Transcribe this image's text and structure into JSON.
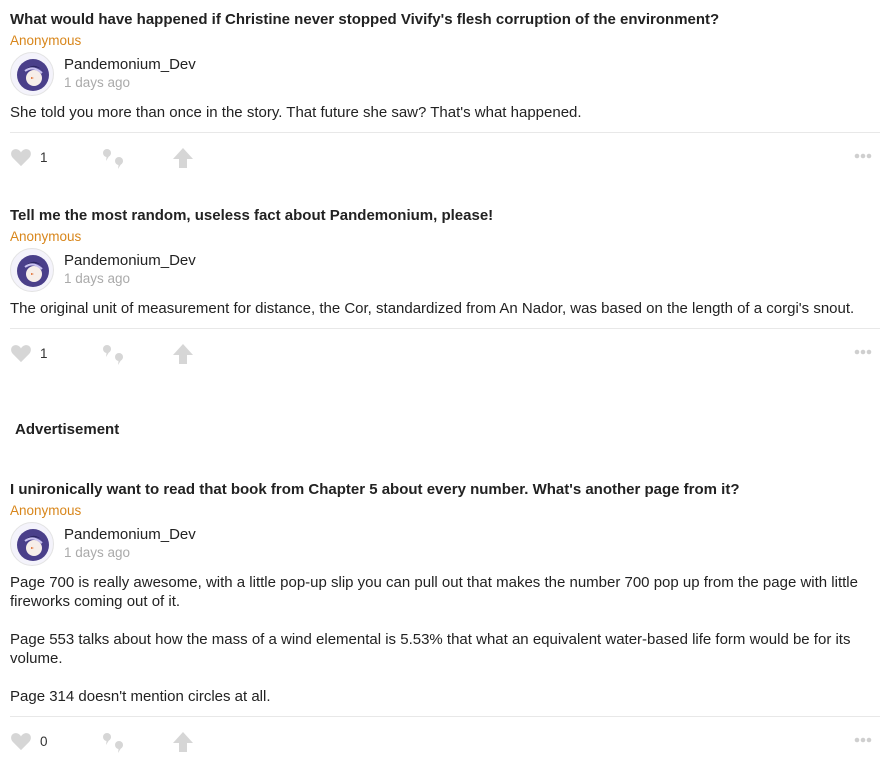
{
  "posts": [
    {
      "question": "What would have happened if Christine never stopped Vivify's flesh corruption of the environment?",
      "asker": "Anonymous",
      "author": "Pandemonium_Dev",
      "time": "1 days ago",
      "answer": [
        "She told you more than once in the story. That future she saw? That's what happened."
      ],
      "likes": "1"
    },
    {
      "question": "Tell me the most random, useless fact about Pandemonium, please!",
      "asker": "Anonymous",
      "author": "Pandemonium_Dev",
      "time": "1 days ago",
      "answer": [
        "The original unit of measurement for distance, the Cor, standardized from An Nador, was based on the length of a corgi's snout."
      ],
      "likes": "1"
    },
    {
      "question": "I unironically want to read that book from Chapter 5 about every number. What's another page from it?",
      "asker": "Anonymous",
      "author": "Pandemonium_Dev",
      "time": "1 days ago",
      "answer": [
        "Page 700 is really awesome, with a little pop-up slip you can pull out that makes the number 700 pop up from the page with little fireworks coming out of it.",
        "Page 553 talks about how the mass of a wind elemental is 5.53% that what an equivalent water-based life form would be for its volume.",
        "Page 314 doesn't mention circles at all."
      ],
      "likes": "0"
    }
  ],
  "advertisement_label": "Advertisement",
  "icons": {
    "like": "heart-icon",
    "quote": "quote-icon",
    "share": "share-arrow-icon",
    "more": "more-dots-icon",
    "avatar": "avatar"
  },
  "colors": {
    "asker": "#d8861b",
    "icon": "#d4d4d4",
    "time": "#aaaaaa"
  }
}
